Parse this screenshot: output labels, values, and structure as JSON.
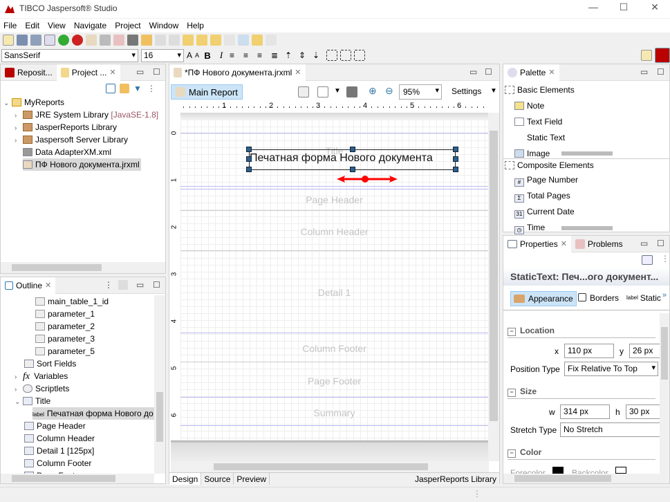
{
  "window": {
    "title": "TIBCO Jaspersoft® Studio",
    "minimize": "—",
    "maximize": "☐",
    "close": "✕"
  },
  "menu": [
    "File",
    "Edit",
    "View",
    "Navigate",
    "Project",
    "Window",
    "Help"
  ],
  "format_toolbar": {
    "font_family": "SansSerif",
    "font_size": "16",
    "bold": "B",
    "italic": "I"
  },
  "left_top": {
    "tabs": [
      {
        "label": "Reposit..."
      },
      {
        "label": "Project ..."
      }
    ],
    "tree": [
      {
        "label": "MyReports",
        "expanded": true,
        "level": 0
      },
      {
        "label": "JRE System Library",
        "suffix": "[JavaSE-1.8]",
        "level": 1
      },
      {
        "label": "JasperReports Library",
        "level": 1
      },
      {
        "label": "Jaspersoft Server Library",
        "level": 1
      },
      {
        "label": "Data AdapterXM.xml",
        "level": 1
      },
      {
        "label": "ПФ Нового документа.jrxml",
        "level": 1,
        "selected": true
      }
    ]
  },
  "outline": {
    "title": "Outline",
    "items": [
      {
        "label": "main_table_1_id",
        "level": 3,
        "icon": "field"
      },
      {
        "label": "parameter_1",
        "level": 3,
        "icon": "field"
      },
      {
        "label": "parameter_2",
        "level": 3,
        "icon": "field"
      },
      {
        "label": "parameter_3",
        "level": 3,
        "icon": "field"
      },
      {
        "label": "parameter_5",
        "level": 3,
        "icon": "field"
      },
      {
        "label": "Sort Fields",
        "level": 2,
        "icon": "sort"
      },
      {
        "label": "Variables",
        "level": 2,
        "icon": "fx",
        "chev": ">"
      },
      {
        "label": "Scriptlets",
        "level": 2,
        "icon": "cup",
        "chev": ">"
      },
      {
        "label": "Title",
        "level": 2,
        "icon": "band",
        "chev": "v"
      },
      {
        "label": "Печатная форма Нового до",
        "level": 3,
        "icon": "label",
        "selected": true
      },
      {
        "label": "Page Header",
        "level": 2,
        "icon": "band"
      },
      {
        "label": "Column Header",
        "level": 2,
        "icon": "band"
      },
      {
        "label": "Detail 1 [125px]",
        "level": 2,
        "icon": "band"
      },
      {
        "label": "Column Footer",
        "level": 2,
        "icon": "band"
      },
      {
        "label": "Page Footer",
        "level": 2,
        "icon": "band"
      }
    ]
  },
  "editor": {
    "tab": "*ПФ Нового документа.jrxml",
    "main_report": "Main Report",
    "zoom": "95%",
    "settings": "Settings",
    "ruler": [
      "1",
      "2",
      "3",
      "4",
      "5",
      "6"
    ],
    "vruler": [
      "0",
      "1",
      "2",
      "3",
      "4",
      "5",
      "6"
    ],
    "element_text": "Печатная форма Нового документа",
    "bands": {
      "title": "Title",
      "page_header": "Page Header",
      "column_header": "Column Header",
      "detail": "Detail 1",
      "column_footer": "Column Footer",
      "page_footer": "Page Footer",
      "summary": "Summary"
    },
    "bottom_tabs": [
      "Design",
      "Source",
      "Preview"
    ],
    "active_bottom_tab": "Design",
    "library": "JasperReports Library"
  },
  "palette": {
    "title": "Palette",
    "basic": "Basic Elements",
    "basic_items": [
      "Note",
      "Text Field",
      "Static Text",
      "Image"
    ],
    "composite": "Composite Elements",
    "composite_items": [
      "Page Number",
      "Total Pages",
      "Current Date",
      "Time"
    ]
  },
  "properties": {
    "tabs": [
      "Properties",
      "Problems"
    ],
    "header": "StaticText: Печ...ого документ...",
    "subtabs": [
      "Appearance",
      "Borders",
      "Static"
    ],
    "active_subtab": "Appearance",
    "location": {
      "title": "Location",
      "x": "110 px",
      "y": "26 px",
      "position_type_label": "Position Type",
      "position_type": "Fix Relative To Top"
    },
    "size": {
      "title": "Size",
      "w": "314 px",
      "h": "30 px",
      "stretch_type_label": "Stretch Type",
      "stretch_type": "No Stretch"
    },
    "color": {
      "title": "Color",
      "forecolor_label": "Forecolor",
      "backcolor_label": "Backcolor",
      "forecolor": "#000000",
      "backcolor": "#ffffff"
    }
  },
  "colors": {
    "accent": "#cce4f7",
    "selection": "#d9d9d9",
    "handle": "#2d5f8e",
    "band_line": "#b8b8f0"
  }
}
